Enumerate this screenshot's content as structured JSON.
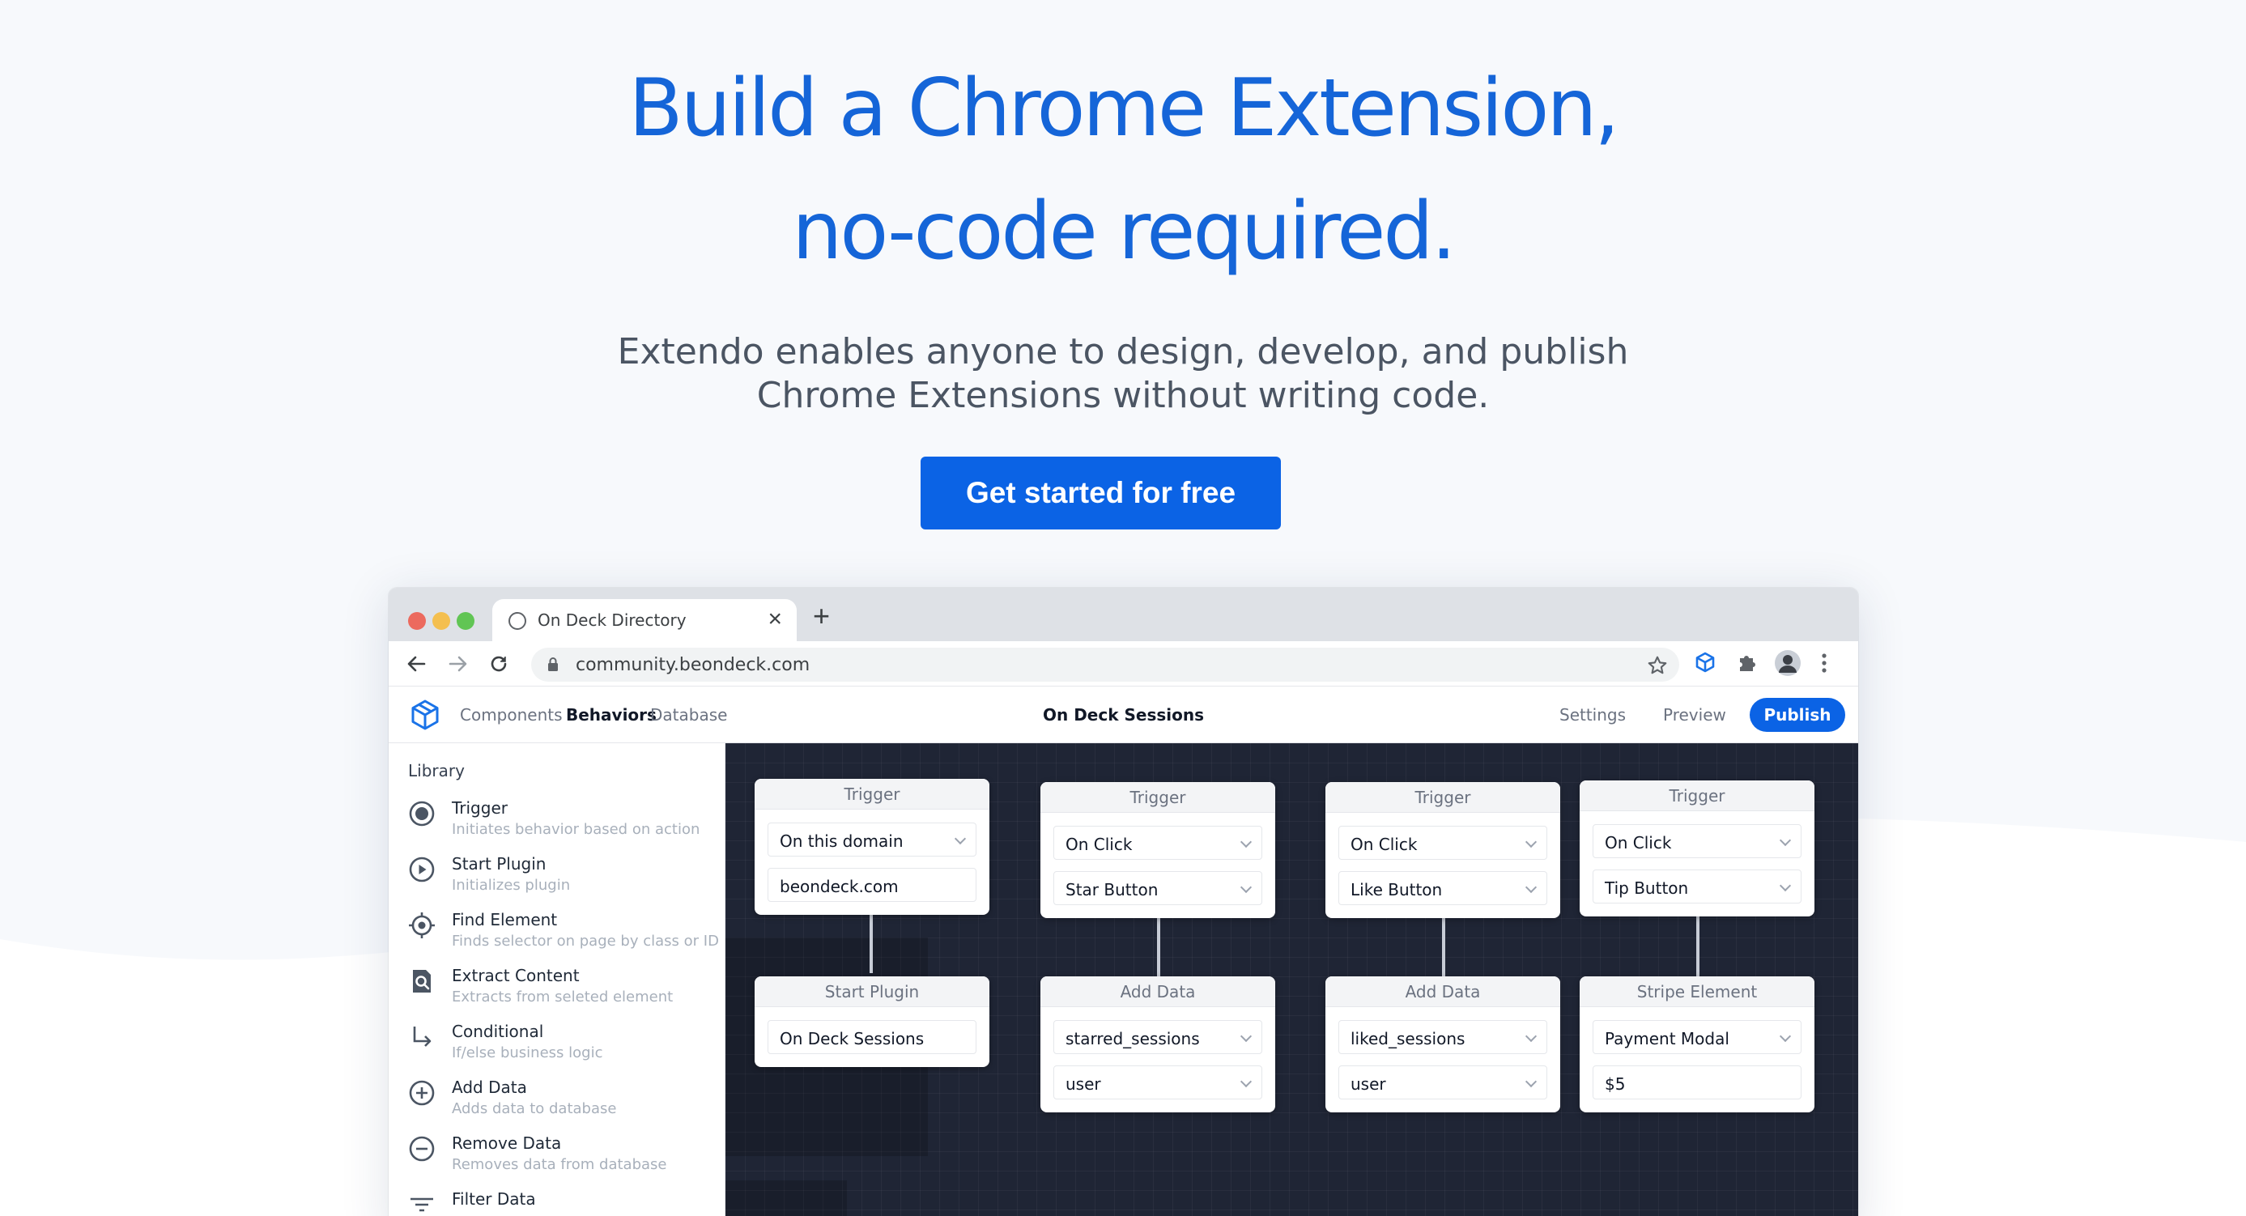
{
  "hero": {
    "headline_line1": "Build a Chrome Extension,",
    "headline_line2": "no-code required.",
    "subtitle_line1": "Extendo enables anyone to design, develop, and publish",
    "subtitle_line2": "Chrome Extensions without writing code.",
    "cta_label": "Get started for free"
  },
  "colors": {
    "accent": "#0b63e5",
    "headline": "#1565d8",
    "canvas_bg": "#1f2535"
  },
  "browser": {
    "tab_title": "On Deck Directory",
    "tab_close": "×",
    "new_tab": "+",
    "url": "community.beondeck.com",
    "icons": [
      "back-icon",
      "forward-icon",
      "reload-icon",
      "lock-icon",
      "star-icon",
      "extendo-extension-icon",
      "puzzle-icon",
      "profile-avatar",
      "kebab-menu-icon"
    ]
  },
  "app": {
    "nav": [
      "Components",
      "Behaviors",
      "Database"
    ],
    "active_nav": "Behaviors",
    "title": "On Deck Sessions",
    "settings_label": "Settings",
    "preview_label": "Preview",
    "publish_label": "Publish"
  },
  "library": {
    "title": "Library",
    "items": [
      {
        "name": "Trigger",
        "desc": "Initiates behavior based on action",
        "icon": "target-circle-icon"
      },
      {
        "name": "Start Plugin",
        "desc": "Initializes plugin",
        "icon": "play-circle-icon"
      },
      {
        "name": "Find Element",
        "desc": "Finds selector on page by class or ID",
        "icon": "crosshair-icon"
      },
      {
        "name": "Extract Content",
        "desc": "Extracts from seleted element",
        "icon": "document-search-icon"
      },
      {
        "name": "Conditional",
        "desc": "If/else business logic",
        "icon": "corner-arrow-icon"
      },
      {
        "name": "Add Data",
        "desc": "Adds data to database",
        "icon": "plus-circle-icon"
      },
      {
        "name": "Remove Data",
        "desc": "Removes data from database",
        "icon": "minus-circle-icon"
      },
      {
        "name": "Filter Data",
        "desc": "",
        "icon": "filter-icon"
      }
    ]
  },
  "flow": {
    "col1": {
      "trigger": {
        "header": "Trigger",
        "field1": "On this domain",
        "field2": "beondeck.com"
      },
      "step2": {
        "header": "Start Plugin",
        "field1": "On Deck Sessions"
      }
    },
    "col2": {
      "trigger": {
        "header": "Trigger",
        "field1": "On Click",
        "field2": "Star Button"
      },
      "step2": {
        "header": "Add Data",
        "field1": "starred_sessions",
        "field2": "user"
      }
    },
    "col3": {
      "trigger": {
        "header": "Trigger",
        "field1": "On Click",
        "field2": "Like Button"
      },
      "step2": {
        "header": "Add Data",
        "field1": "liked_sessions",
        "field2": "user"
      }
    },
    "col4": {
      "trigger": {
        "header": "Trigger",
        "field1": "On Click",
        "field2": "Tip Button"
      },
      "step2": {
        "header": "Stripe Element",
        "field1": "Payment Modal",
        "field2": "$5"
      }
    }
  }
}
